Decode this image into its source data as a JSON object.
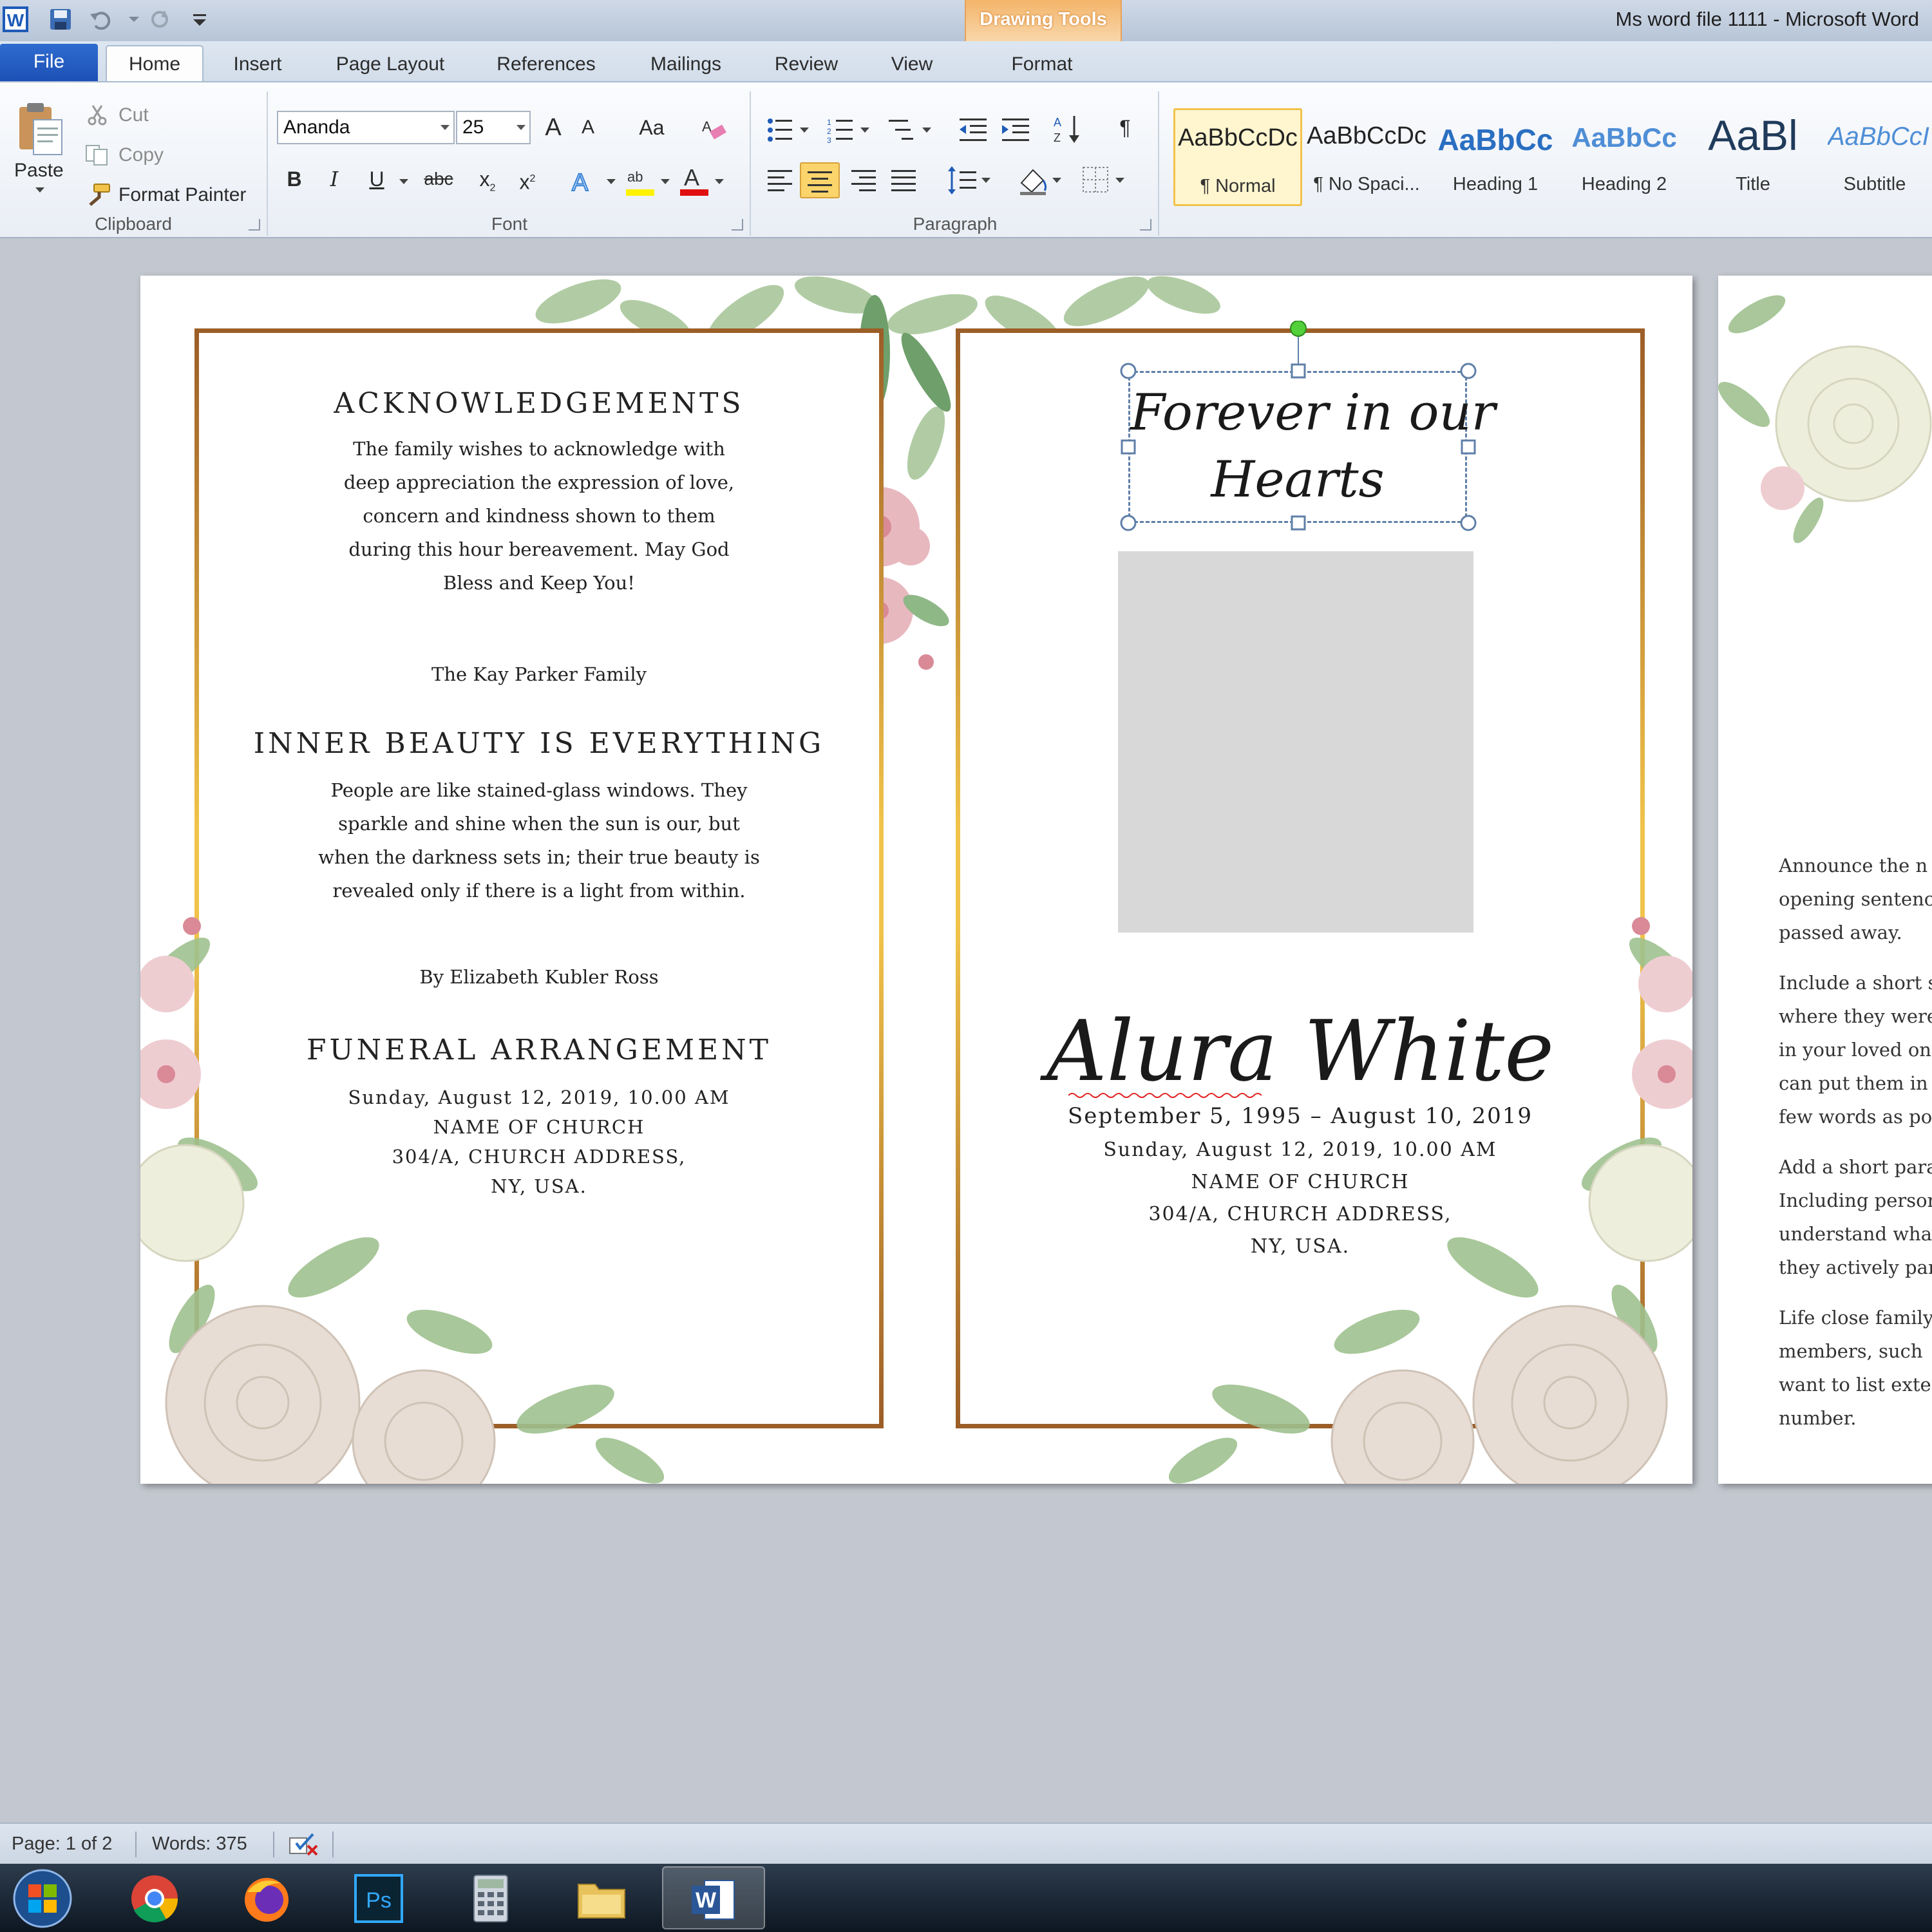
{
  "window": {
    "title": "Ms word file 1111  -  Microsoft Word",
    "context_tab": "Drawing Tools"
  },
  "tabs": {
    "file": "File",
    "home": "Home",
    "insert": "Insert",
    "page_layout": "Page Layout",
    "references": "References",
    "mailings": "Mailings",
    "review": "Review",
    "view": "View",
    "format": "Format"
  },
  "clipboard": {
    "paste": "Paste",
    "cut": "Cut",
    "copy": "Copy",
    "format_painter": "Format Painter",
    "label": "Clipboard"
  },
  "font": {
    "name": "Ananda",
    "size": "25",
    "grow": "A",
    "shrink": "A",
    "change_case": "Aa",
    "bold": "B",
    "italic": "I",
    "underline": "U",
    "strikethrough": "abc",
    "subscript": "x",
    "superscript": "x",
    "label": "Font"
  },
  "paragraph": {
    "label": "Paragraph",
    "pilcrow": "¶"
  },
  "styles": [
    {
      "sample": "AaBbCcDc",
      "name": "¶ Normal",
      "color": "#000000"
    },
    {
      "sample": "AaBbCcDc",
      "name": "¶ No Spaci...",
      "color": "#000000"
    },
    {
      "sample": "AaBbCc",
      "name": "Heading 1",
      "color": "#2a6fc1"
    },
    {
      "sample": "AaBbCc",
      "name": "Heading 2",
      "color": "#4f8ed6"
    },
    {
      "sample": "AaBl",
      "name": "Title",
      "color": "#1f3a5a"
    },
    {
      "sample": "AaBbCcI",
      "name": "Subtitle",
      "color": "#4f8ed6"
    }
  ],
  "doc": {
    "left": {
      "ack_heading": "ACKNOWLEDGEMENTS",
      "ack_lines": [
        "The family wishes to acknowledge with",
        "deep appreciation the expression of love,",
        "concern and kindness shown to them",
        "during this hour bereavement. May God",
        "Bless and Keep You!"
      ],
      "family": "The Kay Parker Family",
      "beauty_heading": "INNER BEAUTY IS EVERYTHING",
      "beauty_lines": [
        "People are like stained-glass windows. They",
        "sparkle and shine when the sun is our, but",
        "when the darkness sets in; their true beauty is",
        "revealed only if there is a light from within."
      ],
      "author": "By Elizabeth Kubler Ross",
      "funeral_heading": "FUNERAL ARRANGEMENT",
      "funeral_lines": [
        "Sunday, August 12, 2019, 10.00 AM",
        "NAME OF CHURCH",
        "304/A, CHURCH ADDRESS,",
        "NY, USA."
      ]
    },
    "right": {
      "title_line1": "Forever in our",
      "title_line2": "Hearts",
      "name": "Alura White",
      "dates": "September 5, 1995 – August 10, 2019",
      "service_lines": [
        "Sunday, August 12, 2019, 10.00 AM",
        "NAME OF CHURCH",
        "304/A, CHURCH ADDRESS,",
        "NY, USA."
      ]
    },
    "page2_lines": [
      "Announce the n",
      "opening sentenc",
      "passed away.",
      "Include a short s",
      "where they were",
      "in your loved on",
      "can put them in c",
      "few words as pos",
      "Add a short parag",
      "Including person",
      "understand wha",
      "they actively par",
      "Life close family",
      "members, such",
      "want to list exte",
      "number."
    ]
  },
  "status": {
    "page": "Page: 1 of 2",
    "words": "Words: 375"
  },
  "taskbar": [
    "start-orb",
    "chrome",
    "firefox",
    "photoshop",
    "calculator",
    "file-explorer",
    "word"
  ],
  "colors": {
    "frame_brown": "#9c5e27",
    "gold": "#f0c34a",
    "accent_blue": "#2a6fc1"
  }
}
